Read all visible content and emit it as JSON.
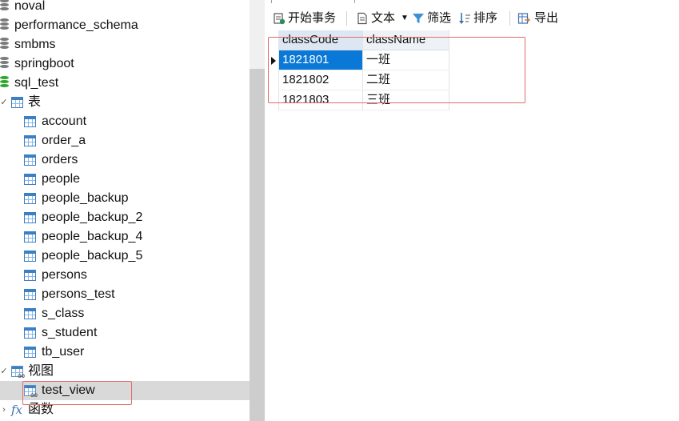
{
  "tree": {
    "databases": [
      {
        "label": "noval",
        "color": "gray"
      },
      {
        "label": "performance_schema",
        "color": "gray"
      },
      {
        "label": "smbms",
        "color": "gray"
      },
      {
        "label": "springboot",
        "color": "gray"
      },
      {
        "label": "sql_test",
        "color": "green"
      }
    ],
    "tables_group": {
      "label": "表",
      "expanded": true
    },
    "tables": [
      "account",
      "order_a",
      "orders",
      "people",
      "people_backup",
      "people_backup_2",
      "people_backup_4",
      "people_backup_5",
      "persons",
      "persons_test",
      "s_class",
      "s_student",
      "tb_user"
    ],
    "views_group": {
      "label": "视图",
      "expanded": true
    },
    "views": [
      "test_view"
    ],
    "functions_group": {
      "label": "函数",
      "expanded": false
    }
  },
  "toolbar": {
    "begin_transaction": "开始事务",
    "text": "文本",
    "filter": "筛选",
    "sort": "排序",
    "export": "导出"
  },
  "grid": {
    "columns": [
      "classCode",
      "className"
    ],
    "rows": [
      [
        "1821801",
        "一班"
      ],
      [
        "1821802",
        "二班"
      ],
      [
        "1821803",
        "三班"
      ]
    ],
    "selected_row": 0
  },
  "colors": {
    "selection": "#0a78d7",
    "highlight_box": "#e36b6b",
    "db_active": "#2fa830"
  }
}
